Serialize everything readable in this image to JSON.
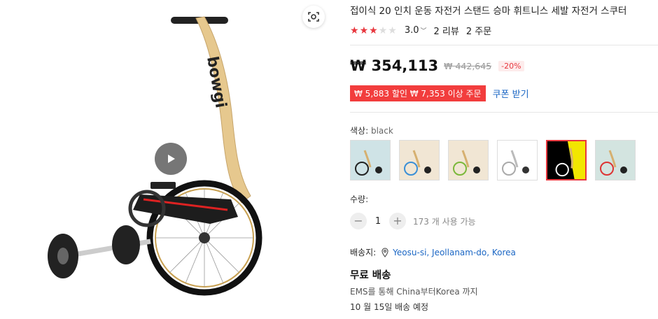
{
  "product": {
    "title": "접이식 20 인치 운동 자전거 스탠드 승마 휘트니스 세발 자전거 스쿠터",
    "brand_on_frame": "bowgi"
  },
  "rating": {
    "value": "3.0",
    "stars_filled": 3,
    "stars_total": 5,
    "reviews": "2 리뷰",
    "orders": "2 주문"
  },
  "price": {
    "current": "₩ 354,113",
    "original": "₩ 442,645",
    "discount": "-20%"
  },
  "coupon": {
    "tag": "₩ 5,883 할인 ₩ 7,353 이상 주문",
    "link": "쿠폰 받기"
  },
  "color": {
    "label": "색상:",
    "selected": "black",
    "options": [
      "option-1",
      "option-2",
      "option-3",
      "option-4",
      "option-5 (selected)",
      "option-6"
    ]
  },
  "quantity": {
    "label": "수량:",
    "value": "1",
    "minus": "−",
    "plus": "+",
    "available": "173 개 사용 가능"
  },
  "shipping": {
    "label": "배송지:",
    "location": "Yeosu-si, Jeollanam-do, Korea",
    "method": "무료 배송",
    "via": "EMS를 통해 China부터Korea 까지",
    "eta": "10 월 15일 배송 예정"
  },
  "colors": {
    "accent": "#e8373e",
    "link": "#1a66c4",
    "coupon_bg": "#f23d3d"
  }
}
